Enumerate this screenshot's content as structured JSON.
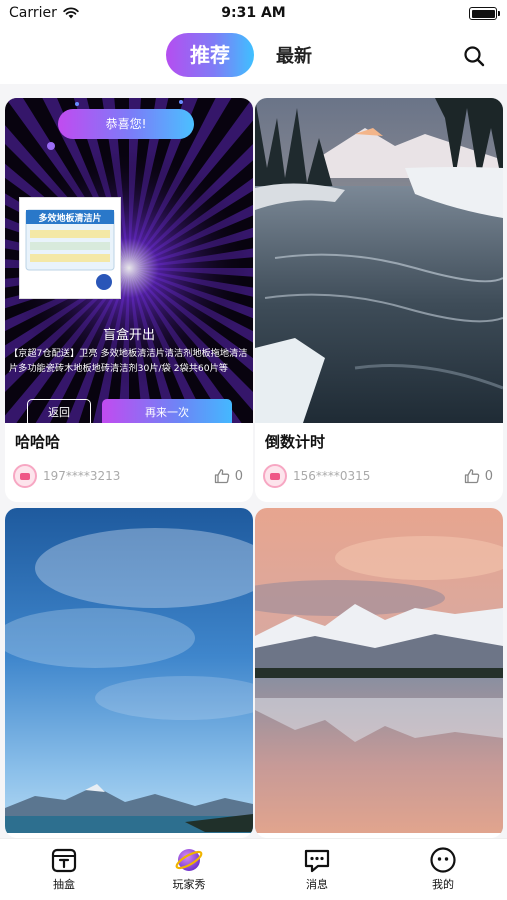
{
  "status_bar": {
    "carrier": "Carrier",
    "time": "9:31 AM"
  },
  "header": {
    "tabs": [
      "推荐",
      "最新"
    ],
    "active_tab": "推荐"
  },
  "blind_box": {
    "congrats": "恭喜您!",
    "product_label_text": "多效地板清洁片",
    "title": "盲盒开出",
    "description": "【京超7仓配送】卫亮 多效地板清洁片清洁剂地板拖地清洁片多功能瓷砖木地板地砖清洁剂30片/袋 2袋共60片等",
    "back_button": "返回",
    "again_button": "再来一次"
  },
  "posts": [
    {
      "title": "哈哈哈",
      "user": "197****3213",
      "likes": "0"
    },
    {
      "title": "倒数计时",
      "user": "156****0315",
      "likes": "0"
    }
  ],
  "tabbar": {
    "items": [
      {
        "label": "抽盒",
        "icon": "blind-box-icon"
      },
      {
        "label": "玩家秀",
        "icon": "planet-icon"
      },
      {
        "label": "消息",
        "icon": "message-icon"
      },
      {
        "label": "我的",
        "icon": "profile-icon"
      }
    ]
  },
  "colors": {
    "gradient_start": "#b54ef0",
    "gradient_end": "#3fc0ff",
    "accent_pink": "#ef5686"
  }
}
